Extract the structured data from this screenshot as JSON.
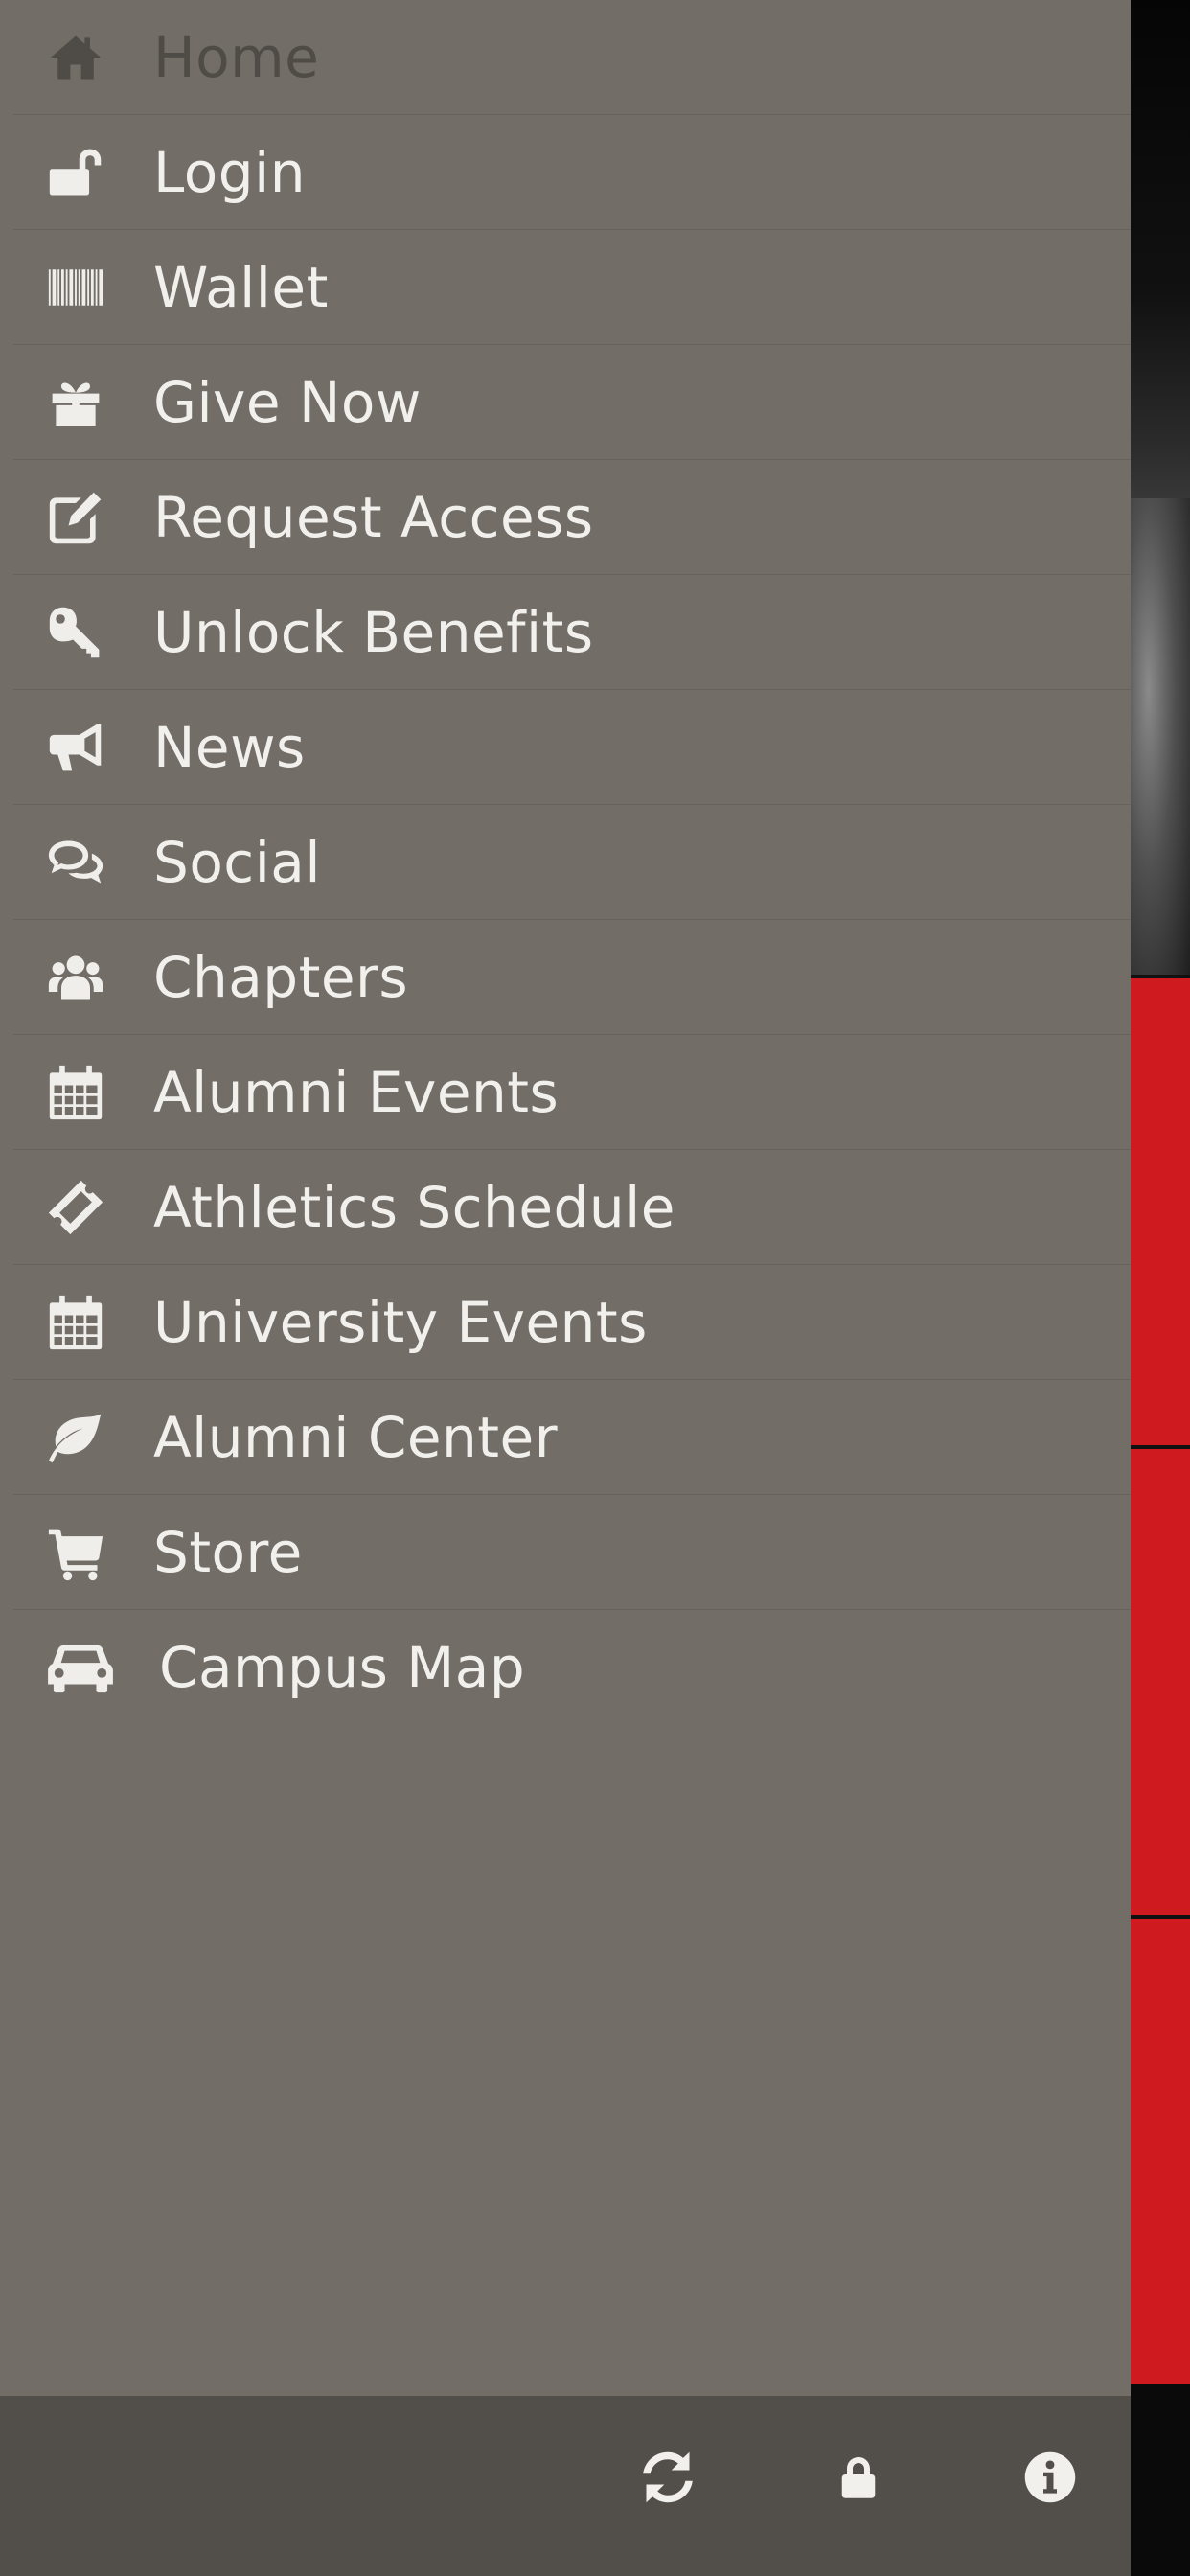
{
  "menu": {
    "items": [
      {
        "label": "Home",
        "icon": "home-icon",
        "active": true
      },
      {
        "label": "Login",
        "icon": "unlock-icon"
      },
      {
        "label": "Wallet",
        "icon": "barcode-icon"
      },
      {
        "label": "Give Now",
        "icon": "gift-icon"
      },
      {
        "label": "Request Access",
        "icon": "edit-icon"
      },
      {
        "label": "Unlock Benefits",
        "icon": "key-icon"
      },
      {
        "label": "News",
        "icon": "bullhorn-icon"
      },
      {
        "label": "Social",
        "icon": "comments-icon"
      },
      {
        "label": "Chapters",
        "icon": "group-icon"
      },
      {
        "label": "Alumni Events",
        "icon": "calendar-icon"
      },
      {
        "label": "Athletics Schedule",
        "icon": "ticket-icon"
      },
      {
        "label": "University Events",
        "icon": "calendar-icon"
      },
      {
        "label": "Alumni Center",
        "icon": "leaf-icon"
      },
      {
        "label": "Store",
        "icon": "shopping-cart-icon"
      },
      {
        "label": "Campus Map",
        "icon": "car-icon"
      }
    ]
  },
  "toolbar": {
    "buttons": [
      {
        "icon": "refresh-icon"
      },
      {
        "icon": "lock-icon"
      },
      {
        "icon": "info-icon"
      }
    ]
  },
  "colors": {
    "drawer_bg": "#726d67",
    "toolbar_bg": "#524f4b",
    "text": "#f2f0ed",
    "active_text": "#4f4b46",
    "accent_red": "#cf1a1f"
  }
}
